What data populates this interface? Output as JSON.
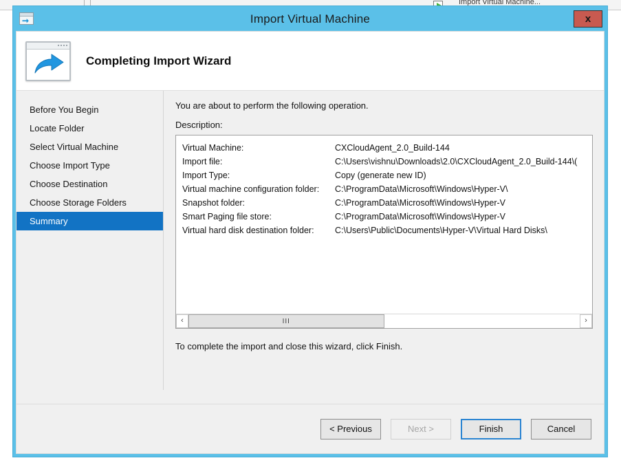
{
  "background": {
    "tab_label_truncated": "Import Virtual Machine...",
    "icon": "import-vm-icon"
  },
  "window": {
    "title": "Import Virtual Machine",
    "icon": "import-arrow-icon",
    "close_label": "x",
    "titlebar_color": "#5bc0e8"
  },
  "banner": {
    "heading": "Completing Import Wizard",
    "icon": "window-with-arrow-icon"
  },
  "sidebar": {
    "items": [
      {
        "label": "Before You Begin",
        "selected": false
      },
      {
        "label": "Locate Folder",
        "selected": false
      },
      {
        "label": "Select Virtual Machine",
        "selected": false
      },
      {
        "label": "Choose Import Type",
        "selected": false
      },
      {
        "label": "Choose Destination",
        "selected": false
      },
      {
        "label": "Choose Storage Folders",
        "selected": false
      },
      {
        "label": "Summary",
        "selected": true
      }
    ],
    "selected_color": "#1273c4"
  },
  "content": {
    "intro": "You are about to perform the following operation.",
    "description_label": "Description:",
    "rows": [
      {
        "key": "Virtual Machine:",
        "value": "CXCloudAgent_2.0_Build-144"
      },
      {
        "key": "Import file:",
        "value": "C:\\Users\\vishnu\\Downloads\\2.0\\CXCloudAgent_2.0_Build-144\\("
      },
      {
        "key": "Import Type:",
        "value": "Copy (generate new ID)"
      },
      {
        "key": "Virtual machine configuration folder:",
        "value": "C:\\ProgramData\\Microsoft\\Windows\\Hyper-V\\"
      },
      {
        "key": "Snapshot folder:",
        "value": "C:\\ProgramData\\Microsoft\\Windows\\Hyper-V"
      },
      {
        "key": "Smart Paging file store:",
        "value": "C:\\ProgramData\\Microsoft\\Windows\\Hyper-V"
      },
      {
        "key": "Virtual hard disk destination folder:",
        "value": "C:\\Users\\Public\\Documents\\Hyper-V\\Virtual Hard Disks\\"
      }
    ],
    "scrollbar": {
      "left_arrow": "‹",
      "right_arrow": "›",
      "thumb_grip": "III"
    },
    "closing": "To complete the import and close this wizard, click Finish."
  },
  "footer": {
    "previous": "< Previous",
    "next": "Next >",
    "finish": "Finish",
    "cancel": "Cancel"
  }
}
